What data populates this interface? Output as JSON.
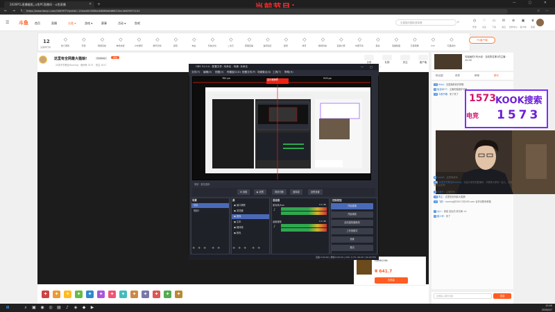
{
  "browser": {
    "tab_title": "2026PCL直播截图_斗鱼PC直播间 - 斗鱼直播",
    "url": "https://www.douyu.com/164997?dyshid=-21eaa0f-0006ec64869a8d66013ec3e009571101",
    "banner": "当前节目："
  },
  "header": {
    "logo": "斗鱼",
    "nav": [
      "首页",
      "直播",
      "分类 ▾",
      "游戏 ▾",
      "赛事",
      "活动 ▾",
      "鱼吧"
    ],
    "search_placeholder": "无畏契约国际冠军赛",
    "icons": [
      {
        "icon": "◷",
        "label": "历史"
      },
      {
        "icon": "♡",
        "label": "关注"
      },
      {
        "icon": "▭",
        "label": "下载"
      },
      {
        "icon": "✉",
        "label": "消息"
      },
      {
        "icon": "⊕",
        "label": "创作中心"
      },
      {
        "icon": "▣",
        "label": "客户端"
      },
      {
        "icon": "♛",
        "label": "贵族"
      }
    ]
  },
  "categories": {
    "count": "12",
    "count_label": "主播排行榜",
    "items": [
      "热门游戏",
      "手游",
      "网游竞技",
      "单机热游",
      "户外娱乐",
      "娱乐天地",
      "颜值",
      "电台",
      "科技文化",
      "二次元",
      "赛事直播",
      "鱼吧社区",
      "星秀",
      "体育",
      "数码科技",
      "直播大赛",
      "中国节奏",
      "美食",
      "英雄联盟",
      "王者荣耀",
      "CS2",
      "无畏契约",
      "绝地求生",
      "原神",
      "和平精英"
    ],
    "pc_button": "PC客户端"
  },
  "room": {
    "title": "这里有全网最大猫娘!",
    "tag": "Cosplay",
    "fav": "关注",
    "subtitle": "20岁不打职业Running · 房间号 3171 · 关注 1017",
    "buttons": [
      "分享",
      "礼物",
      "关注",
      "客户端"
    ]
  },
  "rank": {
    "text": "勾瑶画的1号大叔 · 当前排名第1的主播 · 20:00"
  },
  "chat": {
    "tabs": [
      "粉丝团",
      "贵宾",
      "榜单",
      "聊天"
    ],
    "lines": [
      {
        "badge": "12",
        "name": "Ashy：",
        "text": "这直播看着好舒服"
      },
      {
        "badge": "9",
        "name": "鱼友8877：",
        "text": "主播的猫娘好可爱"
      },
      {
        "badge": "15",
        "name": "今夜不睡：",
        "text": "来了来了"
      },
      {
        "badge": "6",
        "name": "CodeR：",
        "text": "这是啥游戏"
      },
      {
        "badge": "20",
        "name": "20岁不打职业Running：",
        "text": "欢迎大家来到直播间，今晚带大家玩一会儿，请多多关注支持！"
      },
      {
        "badge": "3",
        "name": "小鱼干：",
        "text": "主播在吗"
      },
      {
        "badge": "18",
        "name": "陈主：",
        "text": "这里是全网最大猫娘!"
      },
      {
        "badge": "11",
        "name": "飞跃：",
        "text": "running@20017@163.com 合作请联系邮箱"
      },
      {
        "badge": "7",
        "name": "大川：",
        "text": "感谢 送出的 荧光棒 ×1"
      },
      {
        "badge": "5",
        "name": "路人甲：",
        "text": "来了"
      }
    ],
    "input_placeholder": "这里输入聊天内容",
    "send": "发送"
  },
  "kook": {
    "logo": "1573",
    "sub": "电竞",
    "title": "KOOK搜索",
    "number": "1573"
  },
  "product": {
    "name": "GAMECOIN",
    "price": "¥ 641.7",
    "button": "去购买"
  },
  "obs": {
    "title": "OBS 31.0.4 - 配置文件: 未命名 - 场景: 未命名",
    "menus": [
      "文件(F)",
      "编辑(E)",
      "视图(V)",
      "停靠窗口(D)",
      "配置文件(P)",
      "场景集合(S)",
      "工具(T)",
      "帮助(H)"
    ],
    "scene_label": "场景 · 源无选择",
    "toolbar": [
      "⚙ 设置",
      "▶ 滤镜",
      "场景切换",
      "选择源",
      "滤镜设置"
    ],
    "preview_measure_left": "761 px",
    "preview_measure_right": "919 px",
    "preview_label": "显示器捕获",
    "scenes_title": "场景",
    "scenes": [
      "场景",
      "场景2"
    ],
    "sources_title": "源",
    "sources": [
      "窗口捕获",
      "浏览器",
      "图像",
      "文本",
      "媒体源",
      "颜色"
    ],
    "mixer_title": "混音器",
    "mixer": [
      {
        "name": "麦克风/Aux",
        "db": "0.0 dB"
      },
      {
        "name": "桌面音频",
        "db": "0.0 dB"
      }
    ],
    "controls_title": "控制按钮",
    "controls": [
      "开始直播",
      "开始录制",
      "启动虚拟摄像机",
      "工作室模式",
      "设置",
      "退出"
    ],
    "status": "直播 0:00:00  |  录制 0:00:00  |  CPU: 0.7%, 60.00 / 60.00 FPS"
  },
  "taskbar": {
    "icons": [
      "⊞",
      "⌕",
      "▣",
      "◉",
      "◎",
      "▤",
      "♪",
      "◈",
      "◆",
      "▶"
    ],
    "time": "15:09",
    "date": "2026/4/7"
  }
}
